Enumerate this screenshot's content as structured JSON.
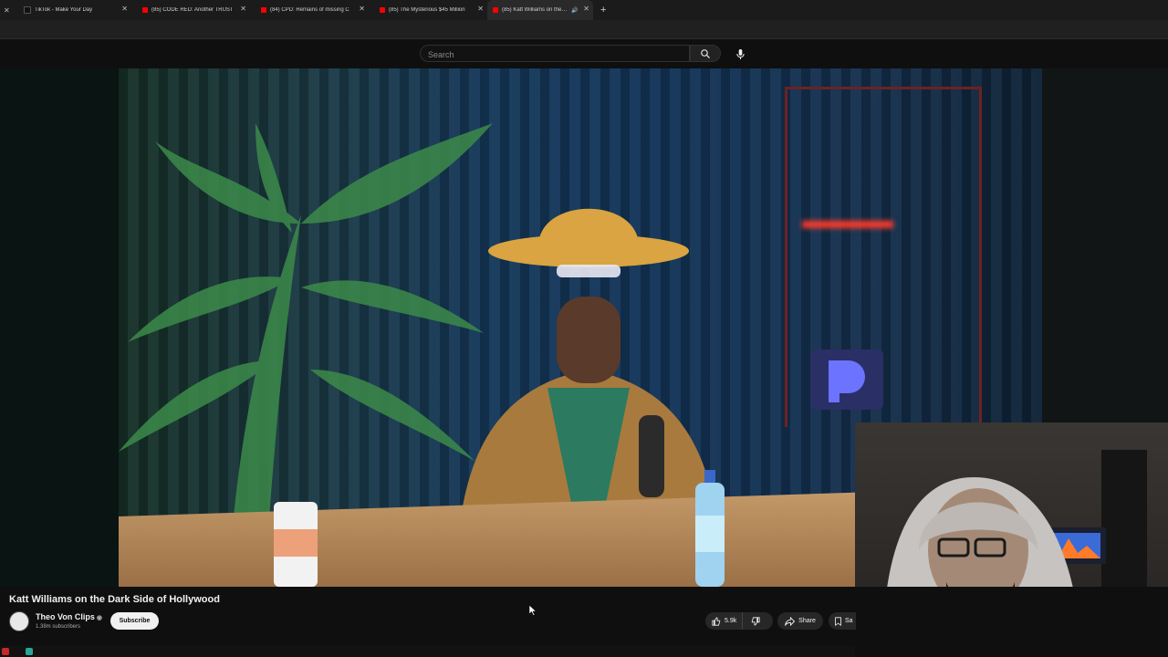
{
  "browser": {
    "tabs": [
      {
        "title": "TikTok - Make Your Day",
        "favicon_color": "#111111",
        "active": false
      },
      {
        "title": "(85) CODE RED: Another TRUST",
        "favicon_color": "#ff0000",
        "active": false
      },
      {
        "title": "(84) CPD: Remains of missing C",
        "favicon_color": "#ff0000",
        "active": false
      },
      {
        "title": "(85) The Mysterious $45 Million",
        "favicon_color": "#ff0000",
        "active": false
      },
      {
        "title": "(85) Katt Williams on the Da",
        "favicon_color": "#ff0000",
        "active": true
      }
    ],
    "new_tab_symbol": "+"
  },
  "header": {
    "search_placeholder": "Search"
  },
  "video": {
    "title": "Katt Williams on the Dark Side of Hollywood",
    "channel_name": "Theo Von Clips",
    "subscribers": "1.38m subscribers",
    "subscribe_label": "Subscribe",
    "likes": "5.9k",
    "share_label": "Share",
    "save_label": "Sa"
  },
  "colors": {
    "background": "#0f0f0f",
    "button_bg": "#272727",
    "subscribe_bg": "#f1f1f1",
    "accent_red": "#ff0000"
  },
  "icons": [
    "search-icon",
    "mic-icon",
    "like-icon",
    "dislike-icon",
    "share-icon",
    "save-icon",
    "verified-icon",
    "tab-close-icon"
  ]
}
